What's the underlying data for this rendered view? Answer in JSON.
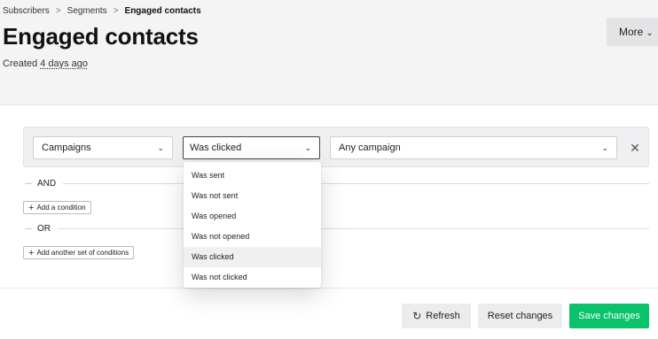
{
  "breadcrumb": {
    "items": [
      "Subscribers",
      "Segments"
    ],
    "separator": ">",
    "current": "Engaged contacts"
  },
  "page": {
    "title": "Engaged contacts",
    "created_prefix": "Created ",
    "created_ago": "4 days ago",
    "more_label": "More"
  },
  "condition": {
    "field": "Campaigns",
    "operator": "Was clicked",
    "value": "Any campaign"
  },
  "dropdown": {
    "options": [
      "Was sent",
      "Was not sent",
      "Was opened",
      "Was not opened",
      "Was clicked",
      "Was not clicked"
    ],
    "selected": "Was clicked"
  },
  "logic": {
    "and_label": "AND",
    "add_condition": "Add a condition",
    "or_label": "OR",
    "add_set": "Add another set of conditions"
  },
  "footer": {
    "refresh": "Refresh",
    "reset": "Reset changes",
    "save": "Save changes"
  },
  "colors": {
    "save_button": "#09c269",
    "page_background": "#f4f4f5"
  }
}
